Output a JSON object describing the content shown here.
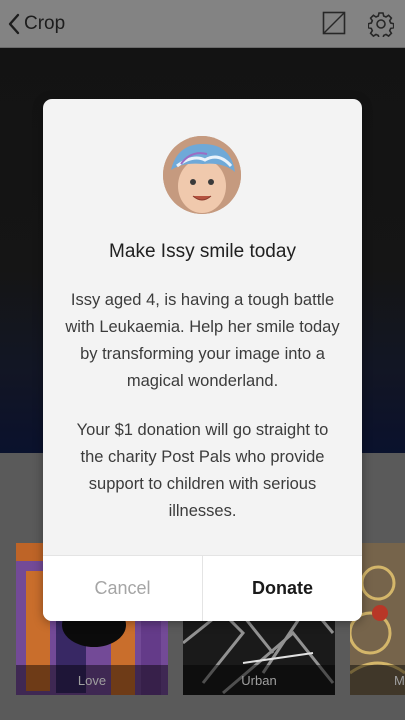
{
  "navbar": {
    "back_label": "Crop",
    "icons": [
      "chevron-left-icon",
      "aspect-ratio-icon",
      "gear-icon"
    ]
  },
  "filters": [
    {
      "label": "Love"
    },
    {
      "label": "Urban"
    },
    {
      "label": "M"
    }
  ],
  "dialog": {
    "title": "Make Issy smile today",
    "paragraph_1": "Issy aged 4, is having a tough battle with Leukaemia. Help her smile today by transforming your image into a magical wonderland.",
    "paragraph_2": "Your $1 donation will go straight to the charity Post Pals who provide support to children with serious illnesses.",
    "cancel_label": "Cancel",
    "donate_label": "Donate"
  },
  "colors": {
    "modal_bg": "#f3f3f3",
    "cancel_text": "#a5a5a5",
    "donate_text": "#1a1a1a"
  }
}
